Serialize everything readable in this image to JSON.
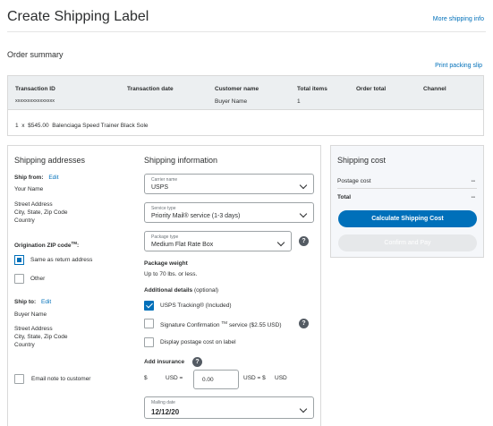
{
  "page": {
    "title": "Create Shipping Label",
    "more_link": "More shipping info"
  },
  "order": {
    "title": "Order summary",
    "print_link": "Print packing slip",
    "headers": [
      "Transaction ID",
      "Transaction date",
      "Customer name",
      "Total items",
      "Order total",
      "Channel"
    ],
    "values": {
      "transaction_id": "xxxxxxxxxxxxxxxx",
      "customer_name": "Buyer Name",
      "total_items": "1"
    },
    "item": "1  x  $545.00  Balenciaga Speed Trainer Black Sole"
  },
  "addresses": {
    "title": "Shipping addresses",
    "ship_from_label": "Ship from:",
    "edit": "Edit",
    "from_name": "Your Name",
    "from_street": "Street Address",
    "from_city": "City, State, Zip Code",
    "from_country": "Country",
    "origination_label": "Origination ZIP code",
    "origination_tm": "TM",
    "origination_colon": ":",
    "same_as_return": "Same as return address",
    "other": "Other",
    "ship_to_label": "Ship to:",
    "to_name": "Buyer Name",
    "to_street": "Street Address",
    "to_city": "City, State, Zip Code",
    "to_country": "Country",
    "email_note": "Email note to customer"
  },
  "shipping": {
    "title": "Shipping information",
    "carrier_label": "Carrier name",
    "carrier_value": "USPS",
    "service_label": "Service type",
    "service_value": "Priority Mail® service (1-3 days)",
    "package_label": "Package type",
    "package_value": "Medium Flat Rate Box",
    "weight_title": "Package weight",
    "weight_value": "Up to 70 lbs. or less.",
    "details_title": "Additional details",
    "details_optional": "(optional)",
    "tracking": "USPS Tracking® (Included)",
    "signature_a": "Signature Confirmation",
    "signature_tm": "TM",
    "signature_b": "service ($2.55 USD)",
    "display_postage": "Display postage cost on label",
    "insurance_title": "Add insurance",
    "dollar": "$",
    "usd_eq": "USD =",
    "insurance_value": "0.00",
    "usd_eq2": "USD = $",
    "usd": "USD",
    "mailing_label": "Mailing date",
    "mailing_value": "12/12/20",
    "help_glyph": "?"
  },
  "cost": {
    "title": "Shipping cost",
    "postage_label": "Postage cost",
    "postage_value": "--",
    "total_label": "Total",
    "total_value": "--",
    "calc_button": "Calculate Shipping Cost",
    "confirm_button": "Confirm and Pay"
  },
  "colors": {
    "accent": "#0070ba",
    "header_bg": "#eceff1",
    "text": "#2c2e2f",
    "muted": "#6c7378"
  }
}
